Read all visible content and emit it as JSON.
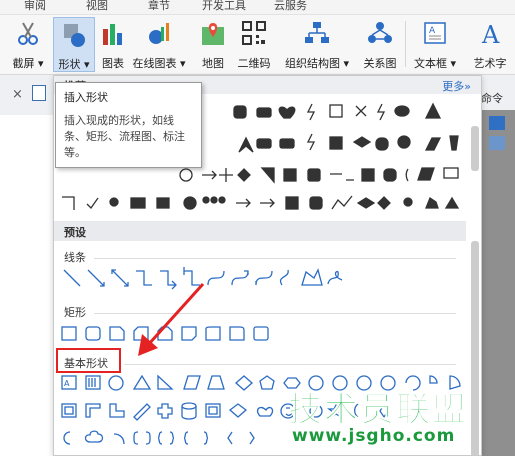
{
  "menu_tabs": [
    "审阅",
    "视图",
    "章节",
    "开发工具",
    "云服务"
  ],
  "ribbon": {
    "screenshot": "截屏",
    "shape": "形状",
    "chart": "图表",
    "online_chart": "在线图表",
    "map": "地图",
    "qrcode": "二维码",
    "org_chart": "组织结构图",
    "relation": "关系图",
    "textbox": "文本框",
    "art": "艺术字"
  },
  "right_cmd": "命令",
  "tooltip": {
    "title": "插入形状",
    "body": "插入现成的形状，如线条、矩形、流程图、标注等。"
  },
  "panel": {
    "header_partial": "推荐",
    "more": "更多»",
    "preset": "预设",
    "lines": "线条",
    "rect": "矩形",
    "basic": "基本形状"
  },
  "watermark": {
    "title": "技术员联盟",
    "url": "www.jsgho.com"
  },
  "colors": {
    "accent": "#2b6cc4",
    "highlight_red": "#e52222",
    "watermark_green": "#1fb84a"
  }
}
